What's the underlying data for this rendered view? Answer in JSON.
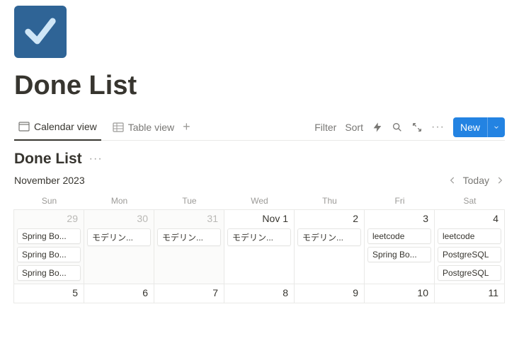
{
  "icon": "checkmark",
  "pageTitle": "Done List",
  "tabs": {
    "calendar": "Calendar view",
    "table": "Table view"
  },
  "toolbar": {
    "filter": "Filter",
    "sort": "Sort",
    "newLabel": "New"
  },
  "dbTitle": "Done List",
  "month": "November 2023",
  "todayLabel": "Today",
  "dow": [
    "Sun",
    "Mon",
    "Tue",
    "Wed",
    "Thu",
    "Fri",
    "Sat"
  ],
  "week1": [
    {
      "label": "29",
      "outside": true,
      "events": [
        "Spring Bo...",
        "Spring Bo...",
        "Spring Bo..."
      ]
    },
    {
      "label": "30",
      "outside": true,
      "events": [
        "モデリン..."
      ]
    },
    {
      "label": "31",
      "outside": true,
      "events": [
        "モデリン..."
      ]
    },
    {
      "label": "Nov 1",
      "events": [
        "モデリン..."
      ]
    },
    {
      "label": "2",
      "events": [
        "モデリン..."
      ]
    },
    {
      "label": "3",
      "events": [
        "leetcode",
        "Spring Bo..."
      ]
    },
    {
      "label": "4",
      "events": [
        "leetcode",
        "PostgreSQL",
        "PostgreSQL"
      ]
    }
  ],
  "week2": [
    {
      "label": "5"
    },
    {
      "label": "6"
    },
    {
      "label": "7"
    },
    {
      "label": "8"
    },
    {
      "label": "9"
    },
    {
      "label": "10"
    },
    {
      "label": "11"
    }
  ]
}
